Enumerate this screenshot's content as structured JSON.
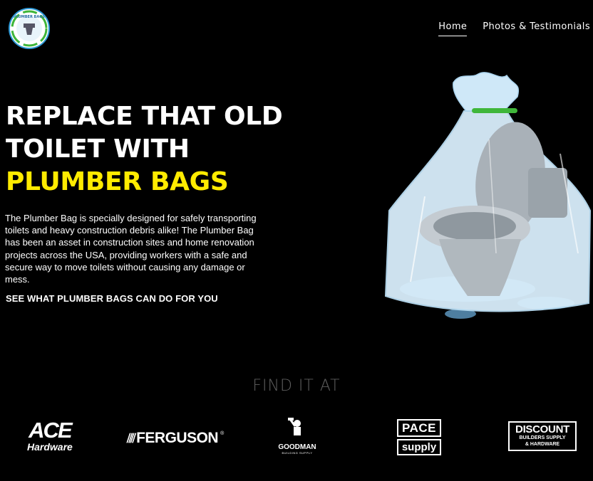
{
  "header": {
    "logo_text": "PLUMBER BAGS",
    "nav": [
      {
        "label": "Home",
        "active": true
      },
      {
        "label": "Photos & Testimonials",
        "active": false
      }
    ]
  },
  "hero": {
    "headline_line1": "REPLACE THAT OLD",
    "headline_line2": "TOILET WITH",
    "headline_highlight": "PLUMBER BAGS",
    "description": "The Plumber Bag is specially designed for safely transporting toilets and heavy construction debris alike! The Plumber Bag has been an asset in construction sites and home renovation projects across the USA, providing workers with a safe and secure way to move toilets without causing any damage or mess.",
    "cta": "SEE WHAT PLUMBER BAGS CAN DO FOR YOU",
    "image": "toilet-in-bag-illustration"
  },
  "find_it": {
    "heading": "FIND IT AT",
    "partners": [
      {
        "name": "ACE",
        "sub": "Hardware"
      },
      {
        "name": "FERGUSON",
        "mark": "®"
      },
      {
        "name": "GOODMAN",
        "sub": "BUILDING SUPPLY"
      },
      {
        "name": "PACE",
        "sub": "supply"
      },
      {
        "name": "DISCOUNT",
        "sub1": "BUILDERS SUPPLY",
        "sub2": "& HARDWARE"
      }
    ]
  },
  "colors": {
    "background": "#000000",
    "highlight": "#ffeb00",
    "muted_heading": "#5f5f5f",
    "bag_tie": "#3fb63a",
    "logo_ring": "#2e9ad8"
  }
}
